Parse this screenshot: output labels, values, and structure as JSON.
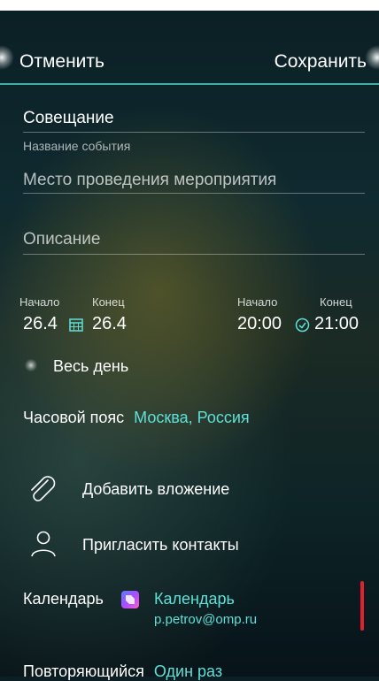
{
  "header": {
    "cancel": "Отменить",
    "save": "Сохранить"
  },
  "event": {
    "title_value": "Совещание",
    "title_label": "Название события",
    "location_placeholder": "Место проведения мероприятия",
    "description_placeholder": "Описание"
  },
  "dates": {
    "start_label": "Начало",
    "end_label": "Конец",
    "start_date": "26.4",
    "end_date": "26.4",
    "start_time_label": "Начало",
    "end_time_label": "Конец",
    "start_time": "20:00",
    "end_time": "21:00"
  },
  "all_day": {
    "label": "Весь день"
  },
  "timezone": {
    "label": "Часовой пояс",
    "value": "Москва, Россия"
  },
  "actions": {
    "attach": "Добавить вложение",
    "invite": "Пригласить контакты"
  },
  "calendar": {
    "label": "Календарь",
    "name": "Календарь",
    "account": "p.petrov@omp.ru"
  },
  "repeat": {
    "label": "Повторяющийся",
    "value": "Один раз"
  },
  "colors": {
    "accent": "#5ee0d8",
    "indicator": "#e0202c"
  },
  "icons": [
    "calendar-grid-icon",
    "clock-icon",
    "paperclip-icon",
    "person-icon",
    "calendar-app-icon"
  ]
}
